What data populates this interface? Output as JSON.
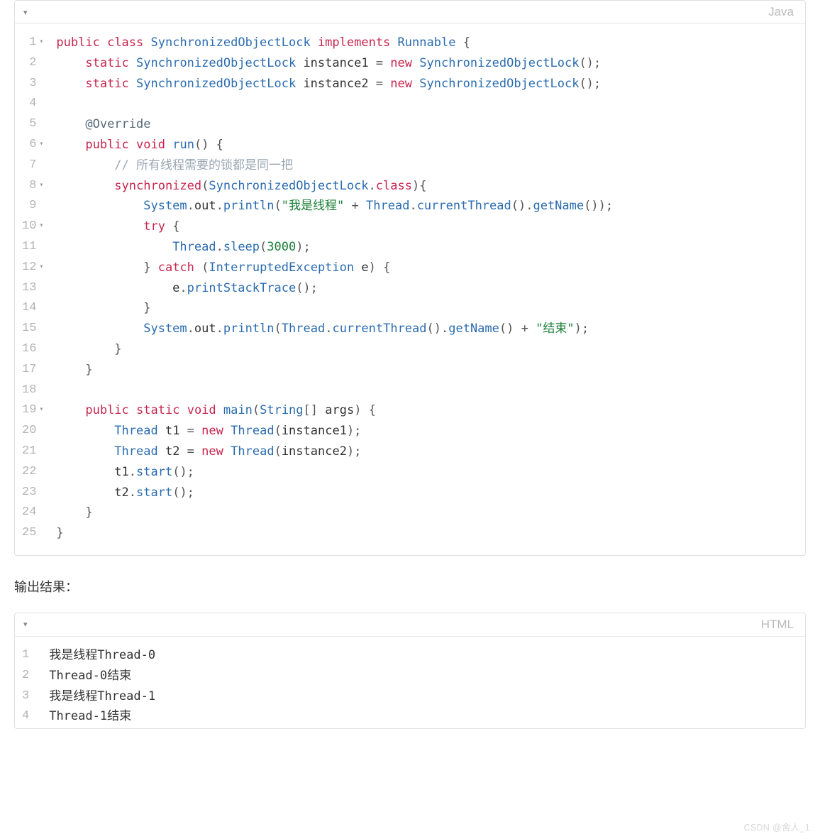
{
  "block1": {
    "lang": "Java",
    "lines": [
      {
        "n": "1",
        "mark": "▾",
        "html": "<span class='kw'>public</span> <span class='kw'>class</span> <span class='cls'>SynchronizedObjectLock</span> <span class='kw'>implements</span> <span class='cls'>Runnable</span> <span class='pun'>{</span>"
      },
      {
        "n": "2",
        "mark": "",
        "html": "    <span class='kw'>static</span> <span class='cls'>SynchronizedObjectLock</span> instance1 <span class='pun'>=</span> <span class='kw'>new</span> <span class='cls'>SynchronizedObjectLock</span><span class='pun'>();</span>"
      },
      {
        "n": "3",
        "mark": "",
        "html": "    <span class='kw'>static</span> <span class='cls'>SynchronizedObjectLock</span> instance2 <span class='pun'>=</span> <span class='kw'>new</span> <span class='cls'>SynchronizedObjectLock</span><span class='pun'>();</span>"
      },
      {
        "n": "4",
        "mark": "",
        "html": ""
      },
      {
        "n": "5",
        "mark": "",
        "html": "    <span class='ann'>@Override</span>"
      },
      {
        "n": "6",
        "mark": "▾",
        "html": "    <span class='kw'>public</span> <span class='kw'>void</span> <span class='fn'>run</span><span class='pun'>() {</span>"
      },
      {
        "n": "7",
        "mark": "",
        "html": "        <span class='cmt'>// 所有线程需要的锁都是同一把</span>"
      },
      {
        "n": "8",
        "mark": "▾",
        "html": "        <span class='kw'>synchronized</span><span class='pun'>(</span><span class='cls'>SynchronizedObjectLock</span><span class='pun'>.</span><span class='kw'>class</span><span class='pun'>){</span>"
      },
      {
        "n": "9",
        "mark": "",
        "html": "            <span class='cls'>System</span><span class='pun'>.</span>out<span class='pun'>.</span><span class='fn'>println</span><span class='pun'>(</span><span class='str'>\"我是线程\"</span> <span class='pun'>+</span> <span class='cls'>Thread</span><span class='pun'>.</span><span class='fn'>currentThread</span><span class='pun'>().</span><span class='fn'>getName</span><span class='pun'>());</span>"
      },
      {
        "n": "10",
        "mark": "▾",
        "html": "            <span class='kw'>try</span> <span class='pun'>{</span>"
      },
      {
        "n": "11",
        "mark": "",
        "html": "                <span class='cls'>Thread</span><span class='pun'>.</span><span class='fn'>sleep</span><span class='pun'>(</span><span class='num'>3000</span><span class='pun'>);</span>"
      },
      {
        "n": "12",
        "mark": "▾",
        "html": "            <span class='pun'>}</span> <span class='kw'>catch</span> <span class='pun'>(</span><span class='cls'>InterruptedException</span> e<span class='pun'>) {</span>"
      },
      {
        "n": "13",
        "mark": "",
        "html": "                e<span class='pun'>.</span><span class='fn'>printStackTrace</span><span class='pun'>();</span>"
      },
      {
        "n": "14",
        "mark": "",
        "html": "            <span class='pun'>}</span>"
      },
      {
        "n": "15",
        "mark": "",
        "html": "            <span class='cls'>System</span><span class='pun'>.</span>out<span class='pun'>.</span><span class='fn'>println</span><span class='pun'>(</span><span class='cls'>Thread</span><span class='pun'>.</span><span class='fn'>currentThread</span><span class='pun'>().</span><span class='fn'>getName</span><span class='pun'>()</span> <span class='pun'>+</span> <span class='str'>\"结束\"</span><span class='pun'>);</span>"
      },
      {
        "n": "16",
        "mark": "",
        "html": "        <span class='pun'>}</span>"
      },
      {
        "n": "17",
        "mark": "",
        "html": "    <span class='pun'>}</span>"
      },
      {
        "n": "18",
        "mark": "",
        "html": ""
      },
      {
        "n": "19",
        "mark": "▾",
        "html": "    <span class='kw'>public</span> <span class='kw'>static</span> <span class='kw'>void</span> <span class='fn'>main</span><span class='pun'>(</span><span class='cls'>String</span><span class='pun'>[]</span> args<span class='pun'>) {</span>"
      },
      {
        "n": "20",
        "mark": "",
        "html": "        <span class='cls'>Thread</span> t1 <span class='pun'>=</span> <span class='kw'>new</span> <span class='cls'>Thread</span><span class='pun'>(</span>instance1<span class='pun'>);</span>"
      },
      {
        "n": "21",
        "mark": "",
        "html": "        <span class='cls'>Thread</span> t2 <span class='pun'>=</span> <span class='kw'>new</span> <span class='cls'>Thread</span><span class='pun'>(</span>instance2<span class='pun'>);</span>"
      },
      {
        "n": "22",
        "mark": "",
        "html": "        t1<span class='pun'>.</span><span class='fn'>start</span><span class='pun'>();</span>"
      },
      {
        "n": "23",
        "mark": "",
        "html": "        t2<span class='pun'>.</span><span class='fn'>start</span><span class='pun'>();</span>"
      },
      {
        "n": "24",
        "mark": "",
        "html": "    <span class='pun'>}</span>"
      },
      {
        "n": "25",
        "mark": "",
        "html": "<span class='pun'>}</span>"
      }
    ]
  },
  "sectionTitle": "输出结果：",
  "block2": {
    "lang": "HTML",
    "lines": [
      {
        "n": "1",
        "text": "我是线程Thread-0"
      },
      {
        "n": "2",
        "text": "Thread-0结束"
      },
      {
        "n": "3",
        "text": "我是线程Thread-1"
      },
      {
        "n": "4",
        "text": "Thread-1结束"
      }
    ]
  },
  "watermark": "CSDN @舍人_1"
}
